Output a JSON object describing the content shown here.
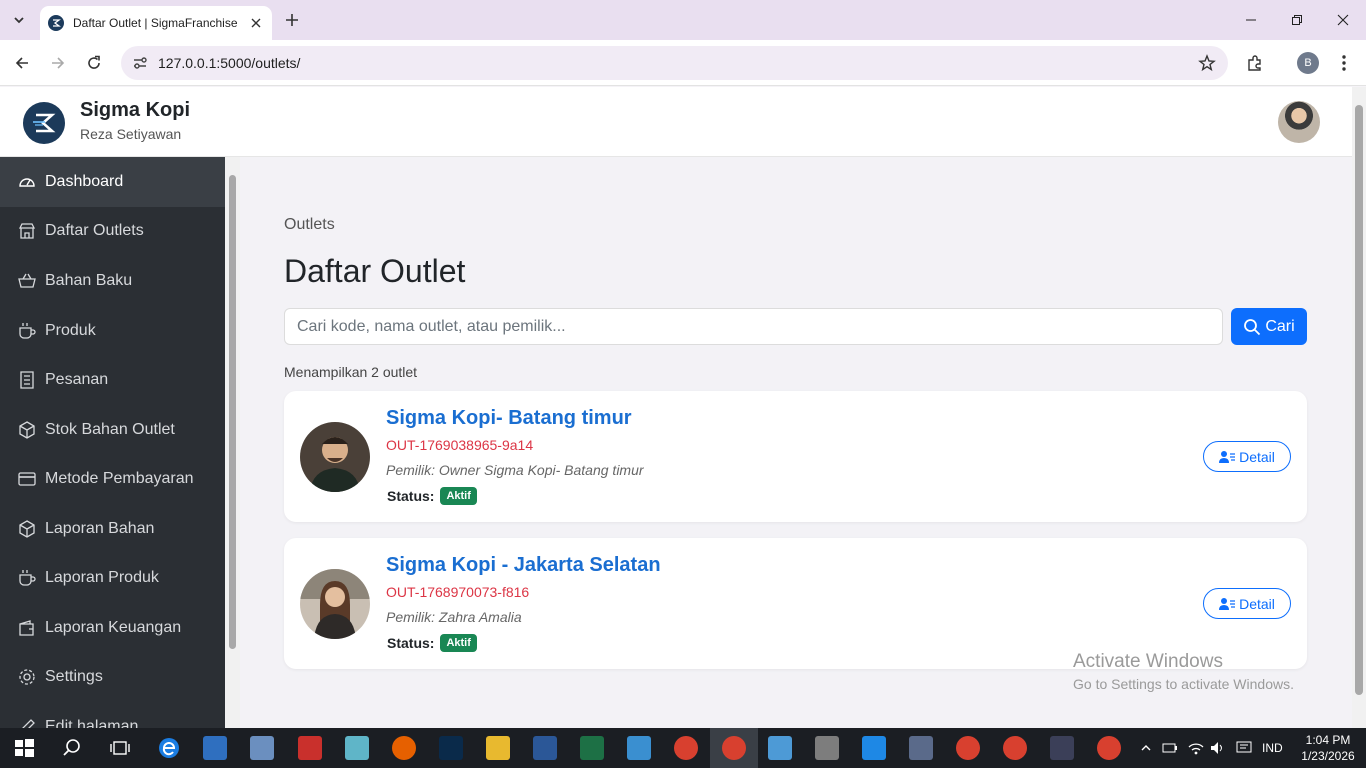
{
  "browser": {
    "tab_title": "Daftar Outlet | SigmaFranchise",
    "url": "127.0.0.1:5000/outlets/",
    "profile_initial": "B"
  },
  "header": {
    "brand": "Sigma Kopi",
    "user": "Reza Setiyawan"
  },
  "sidebar": {
    "items": [
      {
        "label": "Dashboard",
        "icon": "speedometer-icon"
      },
      {
        "label": "Daftar Outlets",
        "icon": "shop-icon"
      },
      {
        "label": "Bahan Baku",
        "icon": "basket-icon"
      },
      {
        "label": "Produk",
        "icon": "cup-icon"
      },
      {
        "label": "Pesanan",
        "icon": "receipt-icon"
      },
      {
        "label": "Stok Bahan Outlet",
        "icon": "box-icon"
      },
      {
        "label": "Metode Pembayaran",
        "icon": "credit-card-icon"
      },
      {
        "label": "Laporan Bahan",
        "icon": "box-icon"
      },
      {
        "label": "Laporan Produk",
        "icon": "cup-icon"
      },
      {
        "label": "Laporan Keuangan",
        "icon": "wallet-icon"
      },
      {
        "label": "Settings",
        "icon": "gear-icon"
      },
      {
        "label": "Edit halaman",
        "icon": "pencil-icon"
      }
    ]
  },
  "main": {
    "breadcrumb": "Outlets",
    "title": "Daftar Outlet",
    "search_placeholder": "Cari kode, nama outlet, atau pemilik...",
    "search_button": "Cari",
    "count_text": "Menampilkan 2 outlet",
    "status_label": "Status:",
    "detail_label": "Detail",
    "outlets": [
      {
        "name": "Sigma Kopi- Batang timur",
        "code": "OUT-1769038965-9a14",
        "owner": "Pemilik: Owner Sigma Kopi- Batang timur",
        "status": "Aktif"
      },
      {
        "name": "Sigma Kopi - Jakarta Selatan",
        "code": "OUT-1768970073-f816",
        "owner": "Pemilik: Zahra Amalia",
        "status": "Aktif"
      }
    ]
  },
  "watermark": {
    "line1": "Activate Windows",
    "line2": "Go to Settings to activate Windows."
  },
  "taskbar": {
    "language": "IND",
    "time": "1:04 PM",
    "date": "1/23/2026"
  }
}
